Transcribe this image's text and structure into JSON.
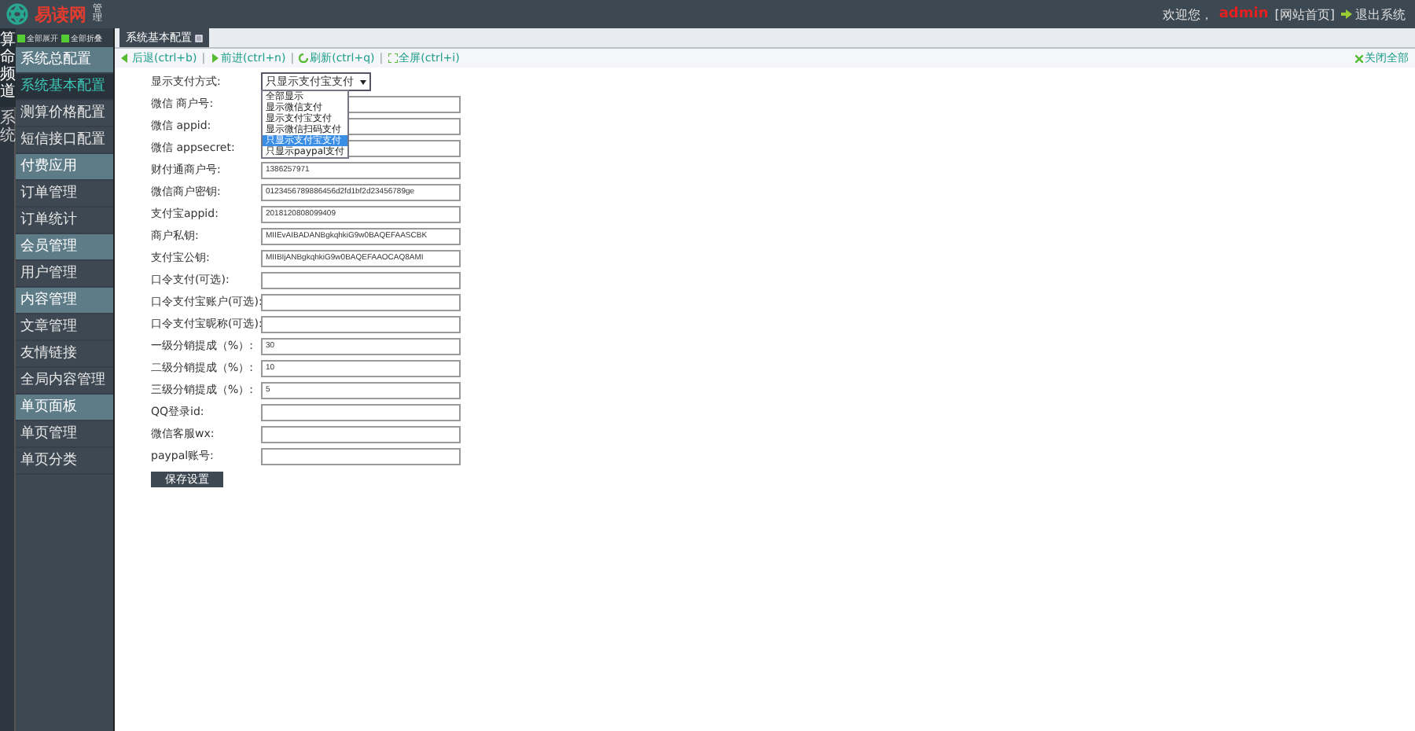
{
  "header": {
    "logo": "易读网",
    "logo_badge": "管理",
    "welcome": "欢迎您，",
    "user": "admin",
    "home_link": "[网站首页]",
    "logout": "退出系统"
  },
  "channel_strip": [
    {
      "label": "算命频道",
      "selected": true
    },
    {
      "label": "系统",
      "selected": false
    }
  ],
  "sidebar": {
    "expand_all": "全部展开",
    "collapse_all": "全部折叠",
    "items": [
      {
        "kind": "section",
        "label": "系统总配置",
        "selected": false
      },
      {
        "kind": "item",
        "label": "系统基本配置",
        "selected": true
      },
      {
        "kind": "item",
        "label": "测算价格配置",
        "selected": false
      },
      {
        "kind": "item",
        "label": "短信接口配置",
        "selected": false
      },
      {
        "kind": "section",
        "label": "付费应用",
        "selected": false
      },
      {
        "kind": "item",
        "label": "订单管理",
        "selected": false
      },
      {
        "kind": "item",
        "label": "订单统计",
        "selected": false
      },
      {
        "kind": "section",
        "label": "会员管理",
        "selected": false
      },
      {
        "kind": "item",
        "label": "用户管理",
        "selected": false
      },
      {
        "kind": "section",
        "label": "内容管理",
        "selected": false
      },
      {
        "kind": "item",
        "label": "文章管理",
        "selected": false
      },
      {
        "kind": "item",
        "label": "友情链接",
        "selected": false
      },
      {
        "kind": "item",
        "label": "全局内容管理",
        "selected": false
      },
      {
        "kind": "section",
        "label": "单页面板",
        "selected": false
      },
      {
        "kind": "item",
        "label": "单页管理",
        "selected": false
      },
      {
        "kind": "item",
        "label": "单页分类",
        "selected": false
      }
    ]
  },
  "tabs": [
    {
      "label": "系统基本配置",
      "selected": true
    }
  ],
  "toolbar": {
    "buttons": [
      {
        "kind": "back",
        "label": "后退(ctrl+b)"
      },
      {
        "kind": "forward",
        "label": "前进(ctrl+n)"
      },
      {
        "kind": "refresh",
        "label": "刷新(ctrl+q)"
      },
      {
        "kind": "fullscreen",
        "label": "全屏(ctrl+i)"
      }
    ],
    "separator": "|",
    "close_all": "关闭全部"
  },
  "form": {
    "fields": [
      {
        "kind": "select",
        "label": "显示支付方式:",
        "value": "只显示支付宝支付",
        "expanded": true,
        "options": [
          {
            "label": "全部显示",
            "selected": false
          },
          {
            "label": "显示微信支付",
            "selected": false
          },
          {
            "label": "显示支付宝支付",
            "selected": false
          },
          {
            "label": "显示微信扫码支付",
            "selected": false
          },
          {
            "label": "只显示支付宝支付",
            "selected": true
          },
          {
            "label": "只显示paypal支付",
            "selected": false
          }
        ]
      },
      {
        "kind": "text",
        "label": "微信 商户号:"
      },
      {
        "kind": "text",
        "label": "微信 appid:"
      },
      {
        "kind": "text",
        "label": "微信 appsecret:"
      },
      {
        "kind": "text",
        "label": "财付通商户号:",
        "value": "1386257971"
      },
      {
        "kind": "text",
        "label": "微信商户密钥:",
        "value": "0123456789886456d2fd1bf2d23456789ge"
      },
      {
        "kind": "text",
        "label": "支付宝appid:",
        "value": "2018120808099409"
      },
      {
        "kind": "text",
        "label": "商户私钥:",
        "value": "MIIEvAIBADANBgkqhkiG9w0BAQEFAASCBK"
      },
      {
        "kind": "text",
        "label": "支付宝公钥:",
        "value": "MIIBIjANBgkqhkiG9w0BAQEFAAOCAQ8AMI"
      },
      {
        "kind": "text",
        "label": "口令支付(可选):"
      },
      {
        "kind": "text",
        "label": "口令支付宝账户(可选):"
      },
      {
        "kind": "text",
        "label": "口令支付宝昵称(可选):"
      },
      {
        "kind": "text",
        "label": "一级分销提成（%）:",
        "value": "30"
      },
      {
        "kind": "text",
        "label": "二级分销提成（%）:",
        "value": "10"
      },
      {
        "kind": "text",
        "label": "三级分销提成（%）:",
        "value": "5"
      },
      {
        "kind": "text",
        "label": "QQ登录id:"
      },
      {
        "kind": "text",
        "label": "微信客服wx:"
      },
      {
        "kind": "text",
        "label": "paypal账号:"
      }
    ],
    "submit": "保存设置"
  }
}
